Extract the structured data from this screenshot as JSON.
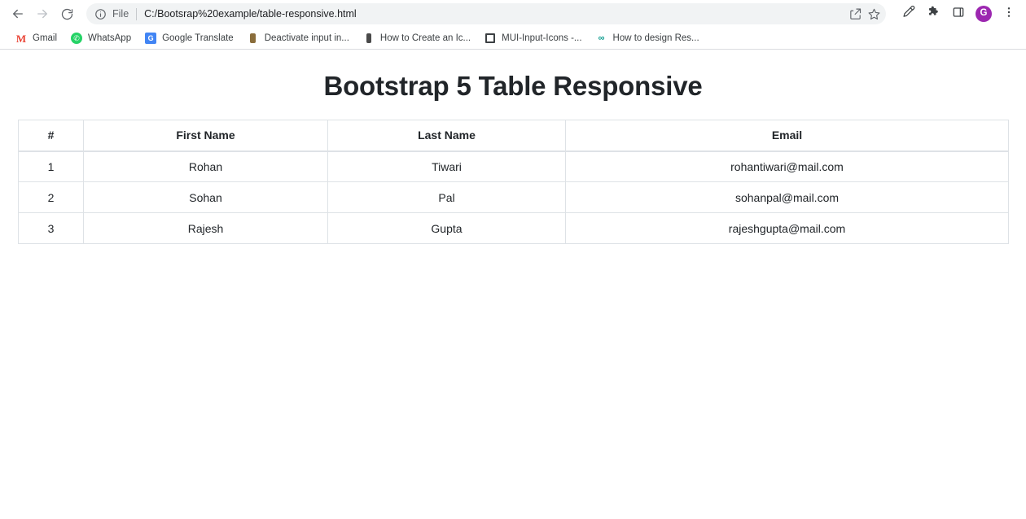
{
  "browser": {
    "nav": {
      "back_icon": "arrow-left-icon",
      "forward_icon": "arrow-right-icon",
      "reload_icon": "reload-icon"
    },
    "omnibox": {
      "info_icon": "info-circle-icon",
      "scheme_label": "File",
      "url": "C:/Bootsrap%20example/table-responsive.html",
      "share_icon": "share-icon",
      "bookmark_star_icon": "star-icon"
    },
    "toolbar_right": {
      "eyedropper_icon": "eyedropper-icon",
      "extensions_icon": "puzzle-piece-icon",
      "side_panel_icon": "side-panel-icon",
      "avatar_initial": "G",
      "avatar_color": "#9c27b0",
      "menu_icon": "three-dot-menu-icon"
    },
    "bookmarks": [
      {
        "label": "Gmail",
        "icon": "gmail-favicon",
        "glyph": "M"
      },
      {
        "label": "WhatsApp",
        "icon": "whatsapp-favicon",
        "glyph": "✆"
      },
      {
        "label": "Google Translate",
        "icon": "google-translate-favicon",
        "glyph": "G"
      },
      {
        "label": "Deactivate input in...",
        "icon": "generic-favicon",
        "glyph": ""
      },
      {
        "label": "How to Create an Ic...",
        "icon": "generic-dark-favicon",
        "glyph": ""
      },
      {
        "label": "MUI-Input-Icons -...",
        "icon": "square-favicon",
        "glyph": ""
      },
      {
        "label": "How to design Res...",
        "icon": "teal-favicon",
        "glyph": "∞"
      }
    ]
  },
  "page": {
    "title": "Bootstrap 5 Table Responsive",
    "table": {
      "headers": [
        "#",
        "First Name",
        "Last Name",
        "Email"
      ],
      "rows": [
        {
          "idx": "1",
          "first": "Rohan",
          "last": "Tiwari",
          "email": "rohantiwari@mail.com"
        },
        {
          "idx": "2",
          "first": "Sohan",
          "last": "Pal",
          "email": "sohanpal@mail.com"
        },
        {
          "idx": "3",
          "first": "Rajesh",
          "last": "Gupta",
          "email": "rajeshgupta@mail.com"
        }
      ]
    }
  }
}
